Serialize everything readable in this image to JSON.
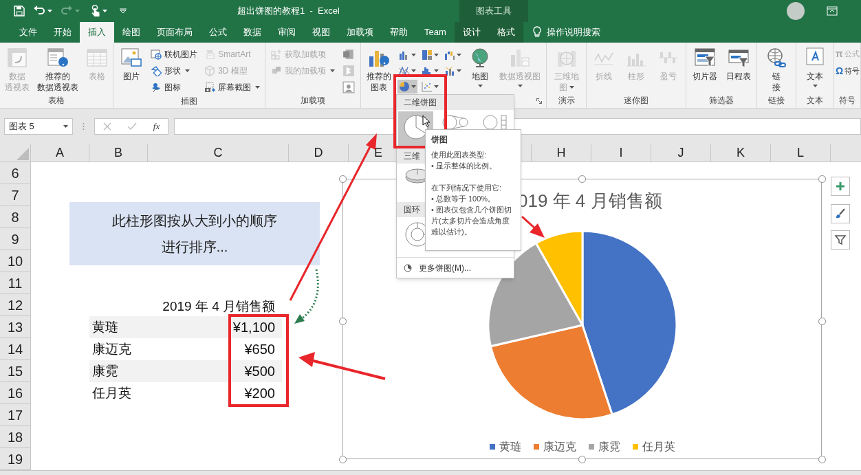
{
  "title_bar": {
    "title": "超出饼图的教程1  -  Excel",
    "context_group": "图表工具"
  },
  "ribbon_tabs": [
    {
      "label": "文件",
      "selected": false,
      "contextual": false
    },
    {
      "label": "开始",
      "selected": false,
      "contextual": false
    },
    {
      "label": "插入",
      "selected": true,
      "contextual": false
    },
    {
      "label": "绘图",
      "selected": false,
      "contextual": false
    },
    {
      "label": "页面布局",
      "selected": false,
      "contextual": false
    },
    {
      "label": "公式",
      "selected": false,
      "contextual": false
    },
    {
      "label": "数据",
      "selected": false,
      "contextual": false
    },
    {
      "label": "审阅",
      "selected": false,
      "contextual": false
    },
    {
      "label": "视图",
      "selected": false,
      "contextual": false
    },
    {
      "label": "加载项",
      "selected": false,
      "contextual": false
    },
    {
      "label": "帮助",
      "selected": false,
      "contextual": false
    },
    {
      "label": "Team",
      "selected": false,
      "contextual": false
    },
    {
      "label": "设计",
      "selected": false,
      "contextual": true
    },
    {
      "label": "格式",
      "selected": false,
      "contextual": true
    }
  ],
  "tell_me": "操作说明搜索",
  "ribbon_groups": [
    {
      "label": "表格",
      "items": [
        {
          "kind": "large",
          "lines": [
            "数据",
            "透视表"
          ],
          "disabled": true,
          "dropdown": false
        },
        {
          "kind": "large",
          "lines": [
            "推荐的",
            "数据透视表"
          ],
          "disabled": false,
          "dropdown": false
        },
        {
          "kind": "large",
          "lines": [
            "表格"
          ],
          "disabled": true,
          "dropdown": false
        }
      ]
    },
    {
      "label": "插图",
      "items": [
        {
          "kind": "large",
          "lines": [
            "图片"
          ],
          "disabled": false,
          "dropdown": false
        },
        {
          "kind": "stack",
          "buttons": [
            {
              "label": "联机图片",
              "disabled": false,
              "dropdown": false
            },
            {
              "label": "形状",
              "disabled": false,
              "dropdown": true
            },
            {
              "label": "图标",
              "disabled": false,
              "dropdown": false
            }
          ]
        },
        {
          "kind": "stack",
          "buttons": [
            {
              "label": "SmartArt",
              "disabled": true,
              "dropdown": false
            },
            {
              "label": "3D 模型",
              "disabled": true,
              "dropdown": false
            },
            {
              "label": "屏幕截图",
              "disabled": false,
              "dropdown": true
            }
          ]
        }
      ]
    },
    {
      "label": "加载项",
      "items": [
        {
          "kind": "stack",
          "buttons": [
            {
              "label": "获取加载项",
              "disabled": true,
              "dropdown": false
            },
            {
              "label": "我的加载项",
              "disabled": true,
              "dropdown": true
            }
          ]
        },
        {
          "kind": "icon_stack"
        }
      ]
    },
    {
      "launcher": true,
      "items": [
        {
          "kind": "large",
          "lines": [
            "推荐的",
            "图表"
          ],
          "disabled": false,
          "dropdown": false
        },
        {
          "kind": "chart_grid",
          "buttons": [
            {
              "open": false
            },
            {
              "open": false
            },
            {
              "open": false
            },
            {
              "open": false
            },
            {
              "open": false
            },
            {
              "open": false
            },
            {
              "open": true
            },
            {
              "open": false
            }
          ]
        },
        {
          "kind": "large",
          "lines": [
            "地图"
          ],
          "disabled": false,
          "dropdown": true
        },
        {
          "kind": "large",
          "lines": [
            "数据透视图"
          ],
          "disabled": true,
          "dropdown": true
        }
      ]
    },
    {
      "label": "演示",
      "items": [
        {
          "kind": "large",
          "lines": [
            "三维地",
            "图"
          ],
          "disabled": true,
          "dropdown": true
        }
      ]
    },
    {
      "label": "迷你图",
      "items": [
        {
          "kind": "large",
          "lines": [
            "折线"
          ],
          "disabled": true,
          "dropdown": false
        },
        {
          "kind": "large",
          "lines": [
            "柱形"
          ],
          "disabled": true,
          "dropdown": false
        },
        {
          "kind": "large",
          "lines": [
            "盈亏"
          ],
          "disabled": true,
          "dropdown": false
        }
      ]
    },
    {
      "label": "筛选器",
      "items": [
        {
          "kind": "large",
          "lines": [
            "切片器"
          ],
          "disabled": false,
          "dropdown": false
        },
        {
          "kind": "large",
          "lines": [
            "日程表"
          ],
          "disabled": false,
          "dropdown": false
        }
      ]
    },
    {
      "label": "链接",
      "items": [
        {
          "kind": "large",
          "lines": [
            "链",
            "接"
          ],
          "disabled": false,
          "dropdown": false
        }
      ]
    },
    {
      "label": "文本",
      "items": [
        {
          "kind": "large",
          "lines": [
            "文本"
          ],
          "disabled": false,
          "dropdown": true
        }
      ]
    },
    {
      "label": "符号",
      "items": [
        {
          "kind": "glyph_stack",
          "buttons": [
            {
              "glyph": "π",
              "label": "公式",
              "disabled": true
            },
            {
              "glyph": "Ω",
              "label": "符号",
              "disabled": false
            }
          ]
        }
      ]
    }
  ],
  "formula_bar": {
    "name_box": "图表 5",
    "function_button": "fx"
  },
  "sheet": {
    "columns_left": [
      "A",
      "B",
      "C",
      "D",
      "E"
    ],
    "columns_right": [
      "H",
      "I",
      "J",
      "K",
      "L"
    ],
    "rows": [
      "6",
      "7",
      "8",
      "9",
      "10",
      "11",
      "12",
      "13",
      "14",
      "15",
      "16",
      "17",
      "18",
      "19"
    ],
    "text_box": "此柱形图按从大到小的顺序进行排序...",
    "table_title": "2019 年 4 月销售额",
    "table_rows": [
      {
        "name": "黄琏",
        "value": "¥1,100",
        "banded": true
      },
      {
        "name": "康迈克",
        "value": "¥650",
        "banded": false
      },
      {
        "name": "康霓",
        "value": "¥500",
        "banded": true
      },
      {
        "name": "任月英",
        "value": "¥200",
        "banded": false
      }
    ]
  },
  "chart": {
    "title": "019 年 4 月销售额",
    "chart_data": {
      "type": "pie",
      "categories": [
        "黄琏",
        "康迈克",
        "康霓",
        "任月英"
      ],
      "values": [
        44.9,
        26.5,
        20.4,
        8.2
      ]
    },
    "legend": [
      {
        "color": "#4472c4"
      },
      {
        "color": "#ed7d31"
      },
      {
        "color": "#a5a5a5"
      },
      {
        "color": "#ffc000"
      }
    ]
  },
  "pie_menu": {
    "sections": [
      {
        "header": "二维饼图",
        "options": [
          {
            "kind": "pie",
            "selected": true
          },
          {
            "kind": "pie_of_pie",
            "selected": false
          },
          {
            "kind": "bar_of_pie",
            "selected": false
          }
        ]
      },
      {
        "header": "三维",
        "options": [
          {
            "kind": "pie_3d",
            "selected": false
          }
        ]
      },
      {
        "header": "圆环",
        "options": [
          {
            "kind": "doughnut",
            "selected": false
          }
        ]
      }
    ],
    "more": "更多饼图(M)..."
  },
  "tooltip": {
    "title": "饼图",
    "paragraphs": [
      "使用此图表类型:",
      "• 显示整体的比例。",
      "在下列情况下使用它:",
      "• 总数等于 100%。",
      "• 图表仅包含几个饼图切片(太多切片会造成角度难以估计)。"
    ]
  }
}
